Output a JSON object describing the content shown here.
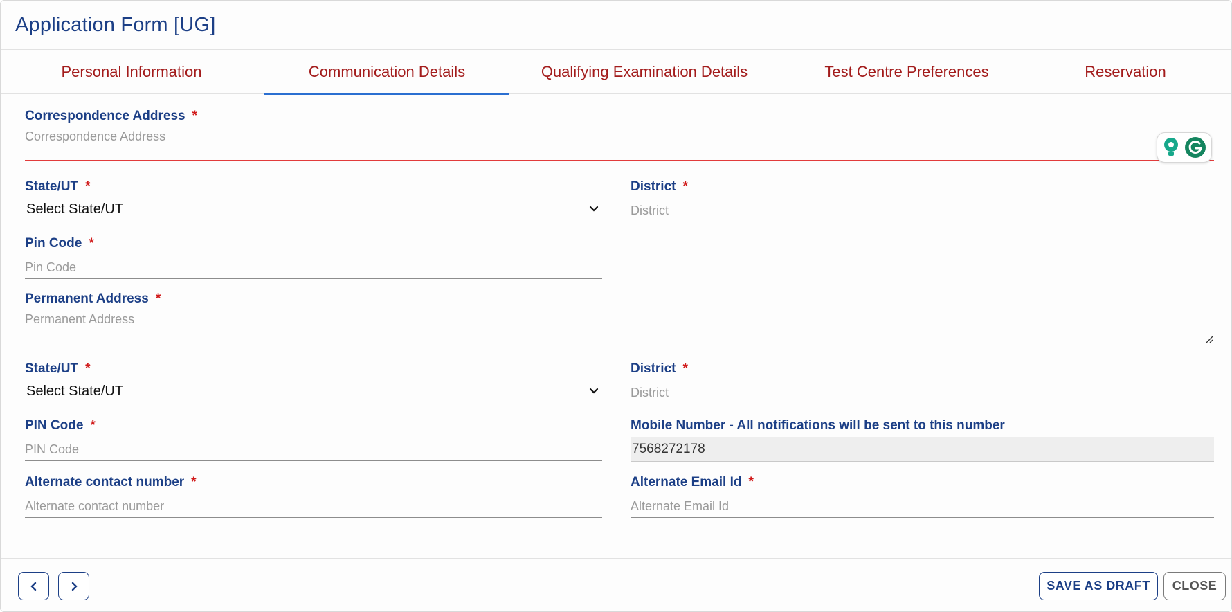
{
  "header": {
    "title": "Application Form [UG]"
  },
  "tabs": [
    {
      "label": "Personal Information",
      "active": false
    },
    {
      "label": "Communication Details",
      "active": true
    },
    {
      "label": "Qualifying Examination Details",
      "active": false
    },
    {
      "label": "Test Centre Preferences",
      "active": false
    },
    {
      "label": "Reservation",
      "active": false
    }
  ],
  "form": {
    "correspondence_address": {
      "label": "Correspondence Address",
      "required": "*",
      "placeholder": "Correspondence Address",
      "value": ""
    },
    "corr_state": {
      "label": "State/UT",
      "required": "*",
      "selected": "Select State/UT"
    },
    "corr_district": {
      "label": "District",
      "required": "*",
      "placeholder": "District",
      "value": ""
    },
    "corr_pin": {
      "label": "Pin Code",
      "required": "*",
      "placeholder": "Pin Code",
      "value": ""
    },
    "permanent_address": {
      "label": "Permanent Address",
      "required": "*",
      "placeholder": "Permanent Address",
      "value": ""
    },
    "perm_state": {
      "label": "State/UT",
      "required": "*",
      "selected": "Select State/UT"
    },
    "perm_district": {
      "label": "District",
      "required": "*",
      "placeholder": "District",
      "value": ""
    },
    "perm_pin": {
      "label": "PIN Code",
      "required": "*",
      "placeholder": "PIN Code",
      "value": ""
    },
    "mobile": {
      "label": "Mobile Number - All notifications will be sent to this number",
      "value": "7568272178"
    },
    "alt_contact": {
      "label": "Alternate contact number",
      "required": "*",
      "placeholder": "Alternate contact number",
      "value": ""
    },
    "alt_email": {
      "label": "Alternate Email Id",
      "required": "*",
      "placeholder": "Alternate Email Id",
      "value": ""
    }
  },
  "footer": {
    "save_draft_label": "SAVE AS DRAFT",
    "close_label": "CLOSE"
  },
  "colors": {
    "primary": "#1c3f86",
    "tab_text": "#a31c1c",
    "tab_active_underline": "#2b6fd1",
    "required": "#d11a1a",
    "error_line": "#e23c3c"
  }
}
